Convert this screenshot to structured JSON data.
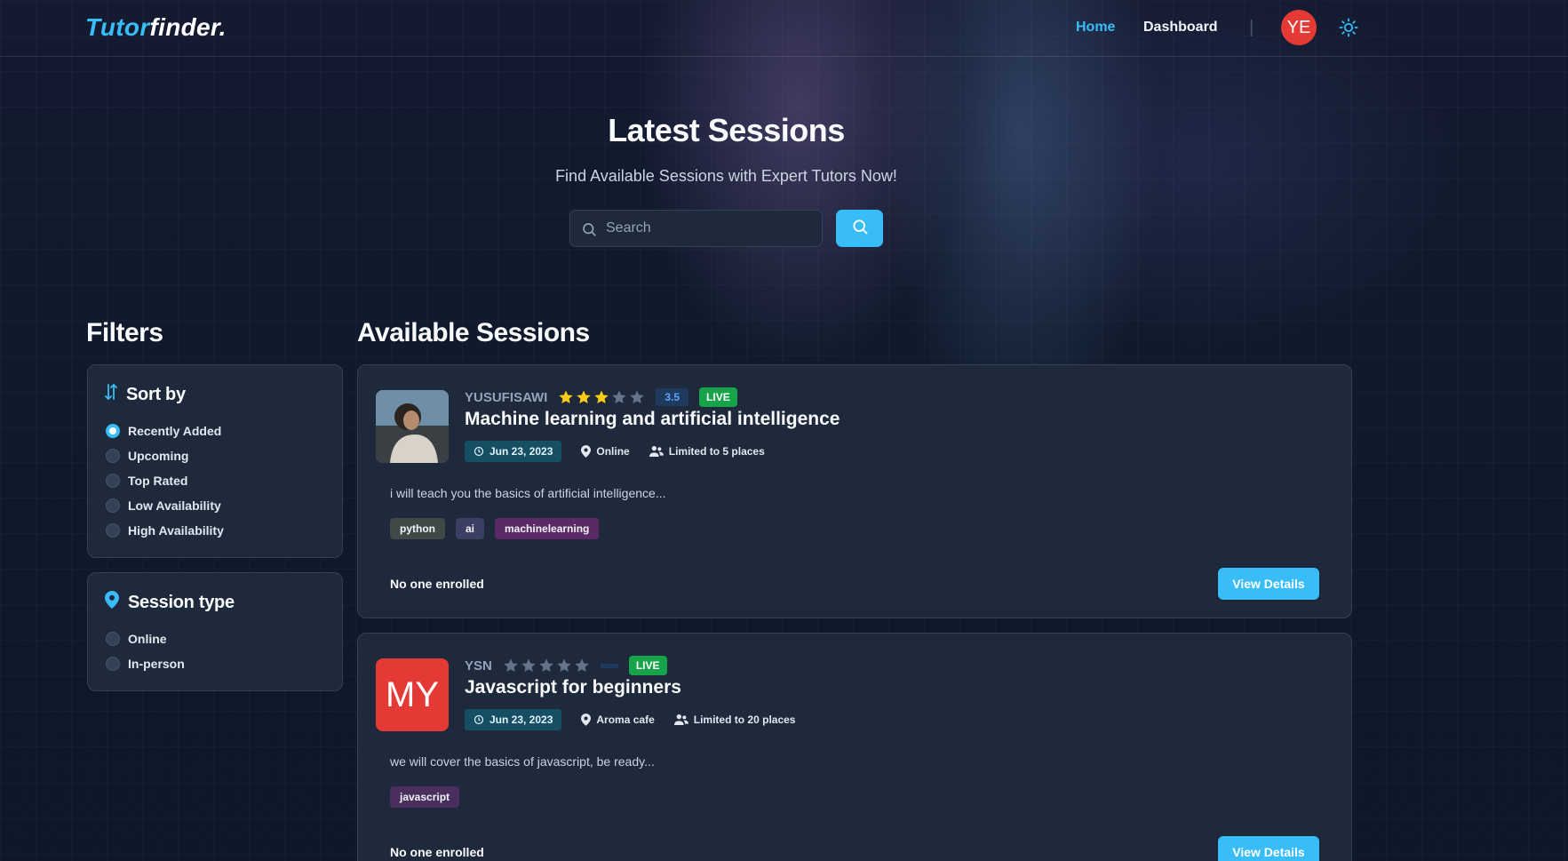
{
  "nav": {
    "logo_part1": "Tutor",
    "logo_part2": "finder.",
    "links": [
      {
        "label": "Home",
        "active": true
      },
      {
        "label": "Dashboard",
        "active": false
      }
    ],
    "separator": "|",
    "avatar_initials": "YE",
    "theme_icon": "sun-icon"
  },
  "hero": {
    "title": "Latest Sessions",
    "subtitle": "Find Available Sessions with Expert Tutors Now!",
    "search_placeholder": "Search",
    "search_value": ""
  },
  "filters": {
    "title": "Filters",
    "sort": {
      "title": "Sort by",
      "icon": "sort-arrows-icon",
      "options": [
        {
          "label": "Recently Added",
          "checked": true
        },
        {
          "label": "Upcoming",
          "checked": false
        },
        {
          "label": "Top Rated",
          "checked": false
        },
        {
          "label": "Low Availability",
          "checked": false
        },
        {
          "label": "High Availability",
          "checked": false
        }
      ]
    },
    "session_type": {
      "title": "Session type",
      "icon": "map-pin-icon",
      "options": [
        {
          "label": "Online",
          "checked": false
        },
        {
          "label": "In-person",
          "checked": false
        }
      ]
    }
  },
  "sessions": {
    "title": "Available Sessions",
    "items": [
      {
        "tutor": "YUSUFISAWI",
        "avatar_type": "photo",
        "rating_stars": 3,
        "rating_value": "3.5",
        "status": "LIVE",
        "title": "Machine learning and artificial intelligence",
        "date": "Jun 23, 2023",
        "location": "Online",
        "capacity": "Limited to 5 places",
        "description": "i will teach you the basics of artificial intelligence...",
        "tags": [
          "python",
          "ai",
          "machinelearning"
        ],
        "enrolled": "No one enrolled",
        "button": "View Details"
      },
      {
        "tutor": "YSN",
        "avatar_type": "initials",
        "avatar_initials": "MY",
        "rating_stars": 0,
        "rating_value": "",
        "status": "LIVE",
        "title": "Javascript for beginners",
        "date": "Jun 23, 2023",
        "location": "Aroma cafe",
        "capacity": "Limited to 20 places",
        "description": "we will cover the basics of javascript, be ready...",
        "tags": [
          "javascript"
        ],
        "enrolled": "No one enrolled",
        "button": "View Details"
      }
    ]
  },
  "colors": {
    "accent": "#38bdf8",
    "background": "#0f172a",
    "card": "#1e293b",
    "live": "#16a34a",
    "star_filled": "#facc15",
    "star_empty": "#64748b",
    "avatar_red": "#e53935"
  }
}
